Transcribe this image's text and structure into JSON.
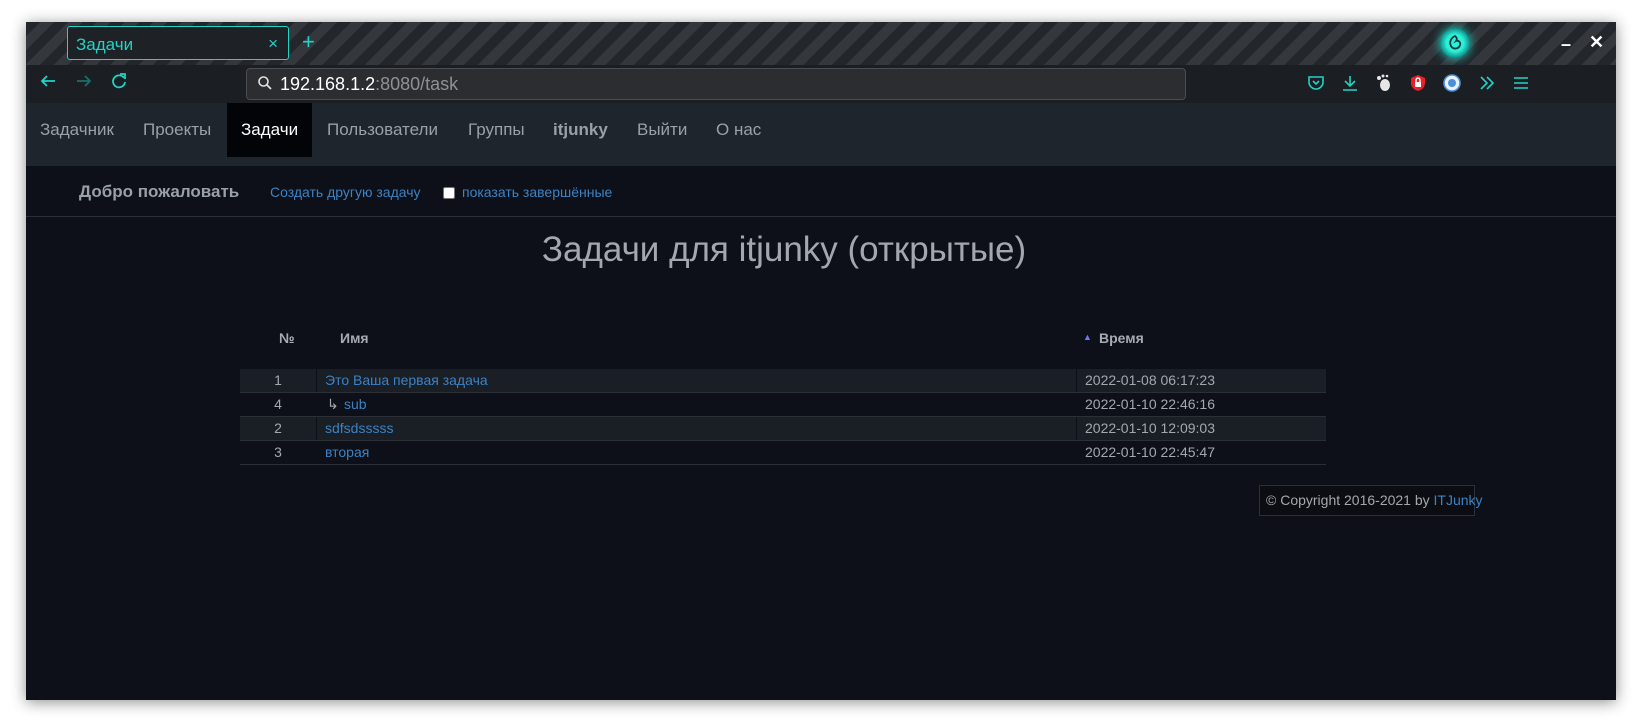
{
  "browser": {
    "tab_title": "Задачи",
    "tab_close": "×",
    "new_tab": "+",
    "url_host": "192.168.1.2",
    "url_rest": ":8080/task",
    "minimize": "–",
    "close": "✕"
  },
  "site_nav": {
    "items": [
      {
        "label": "Задачник"
      },
      {
        "label": "Проекты"
      },
      {
        "label": "Задачи",
        "active": true
      },
      {
        "label": "Пользователи"
      },
      {
        "label": "Группы"
      },
      {
        "label": "itjunky",
        "bold": true
      },
      {
        "label": "Выйти"
      },
      {
        "label": "О нас"
      }
    ]
  },
  "subbar": {
    "welcome": "Добро пожаловать",
    "create_link": "Создать другую задачу",
    "show_completed": "показать завершённые",
    "show_completed_checked": false
  },
  "page_title": "Задачи для itjunky (открытые)",
  "table": {
    "headers": {
      "num": "№",
      "name": "Имя",
      "time": "Время"
    },
    "sort_arrow": "▲",
    "rows": [
      {
        "num": "1",
        "name": "Это Ваша первая задача",
        "time": "2022-01-08 06:17:23"
      },
      {
        "num": "4",
        "arrow": "↳",
        "name": "sub",
        "time": "2022-01-10 22:46:16"
      },
      {
        "num": "2",
        "name": "sdfsdsssss",
        "time": "2022-01-10 12:09:03"
      },
      {
        "num": "3",
        "name": "вторая",
        "time": "2022-01-10 22:45:47"
      }
    ]
  },
  "footer": {
    "text": "© Copyright 2016-2021 by ",
    "link": "ITJunky"
  },
  "colors": {
    "accent": "#22d3c5",
    "link": "#3b82c4",
    "background": "#0d1018"
  }
}
